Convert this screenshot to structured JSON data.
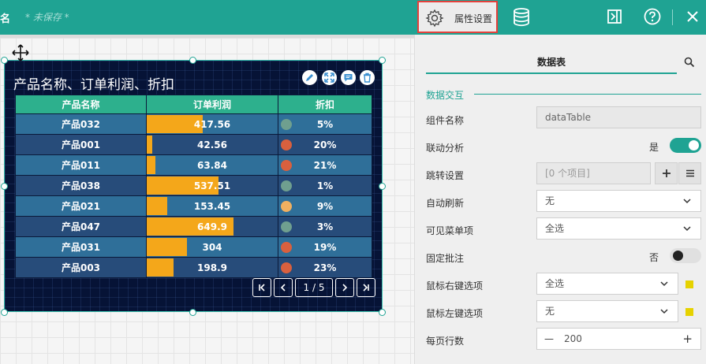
{
  "topbar": {
    "name": "名",
    "unsaved": "* 未保存 *"
  },
  "widget": {
    "title": "产品名称、订单利润、折扣",
    "columns": [
      "产品名称",
      "订单利润",
      "折扣"
    ],
    "rows": [
      {
        "name": "产品032",
        "profit": "417.56",
        "profit_value": 417.56,
        "discount": "5%",
        "dot_color": "#6f9f8f"
      },
      {
        "name": "产品001",
        "profit": "42.56",
        "profit_value": 42.56,
        "discount": "20%",
        "dot_color": "#d9603e"
      },
      {
        "name": "产品011",
        "profit": "63.84",
        "profit_value": 63.84,
        "discount": "21%",
        "dot_color": "#d9603e"
      },
      {
        "name": "产品038",
        "profit": "537.51",
        "profit_value": 537.51,
        "discount": "1%",
        "dot_color": "#6f9f8f"
      },
      {
        "name": "产品021",
        "profit": "153.45",
        "profit_value": 153.45,
        "discount": "9%",
        "dot_color": "#f0b060"
      },
      {
        "name": "产品047",
        "profit": "649.9",
        "profit_value": 649.9,
        "discount": "3%",
        "dot_color": "#6f9f8f"
      },
      {
        "name": "产品031",
        "profit": "304",
        "profit_value": 304,
        "discount": "19%",
        "dot_color": "#d9603e"
      },
      {
        "name": "产品003",
        "profit": "198.9",
        "profit_value": 198.9,
        "discount": "23%",
        "dot_color": "#d9603e"
      }
    ],
    "pager": {
      "first": "|<",
      "prev": "<",
      "page_info": "1 / 5",
      "next": ">",
      "last": ">|"
    }
  },
  "panel": {
    "active_tab": "属性设置",
    "data_tab": "数据表",
    "section": "数据交互",
    "fields": {
      "component_name": {
        "label": "组件名称",
        "value": "dataTable"
      },
      "linkage": {
        "label": "联动分析",
        "state": "是",
        "on": true
      },
      "jump": {
        "label": "跳转设置",
        "value": "[0 个项目]",
        "add": "+",
        "menu": "≡"
      },
      "auto_refresh": {
        "label": "自动刷新",
        "value": "无"
      },
      "visible_menu": {
        "label": "可见菜单项",
        "value": "全选"
      },
      "fixed_note": {
        "label": "固定批注",
        "state": "否",
        "on": false
      },
      "right_click": {
        "label": "鼠标右键选项",
        "value": "全选"
      },
      "left_click": {
        "label": "鼠标左键选项",
        "value": "无"
      },
      "rows_per_page": {
        "label": "每页行数",
        "value": "200",
        "minus": "—",
        "plus": "+"
      }
    }
  },
  "colors": {
    "accent": "#1fa393",
    "highlight": "#e3413c",
    "bar": "#f4a71a"
  }
}
